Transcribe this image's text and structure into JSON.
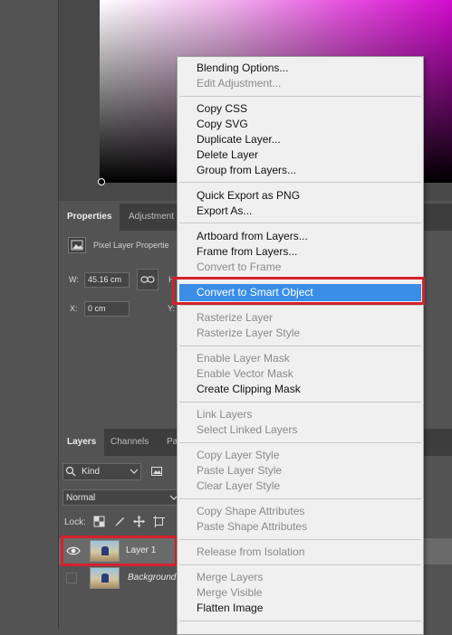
{
  "properties": {
    "tabs": [
      "Properties",
      "Adjustment"
    ],
    "header_label": "Pixel Layer Propertie",
    "w_label": "W:",
    "w_value": "45.16 cm",
    "h_label": "H",
    "x_label": "X:",
    "x_value": "0 cm",
    "y_label": "Y:"
  },
  "layers": {
    "tabs": [
      "Layers",
      "Channels",
      "Pa"
    ],
    "filter_kind": "Kind",
    "blend_mode": "Normal",
    "lock_label": "Lock:",
    "rows": [
      {
        "name": "Layer 1",
        "visible": true
      },
      {
        "name": "Background",
        "visible": false
      }
    ]
  },
  "context_menu": {
    "groups": [
      [
        {
          "label": "Blending Options...",
          "enabled": true
        },
        {
          "label": "Edit Adjustment...",
          "enabled": false
        }
      ],
      [
        {
          "label": "Copy CSS",
          "enabled": true
        },
        {
          "label": "Copy SVG",
          "enabled": true
        },
        {
          "label": "Duplicate Layer...",
          "enabled": true
        },
        {
          "label": "Delete Layer",
          "enabled": true
        },
        {
          "label": "Group from Layers...",
          "enabled": true
        }
      ],
      [
        {
          "label": "Quick Export as PNG",
          "enabled": true
        },
        {
          "label": "Export As...",
          "enabled": true
        }
      ],
      [
        {
          "label": "Artboard from Layers...",
          "enabled": true
        },
        {
          "label": "Frame from Layers...",
          "enabled": true
        },
        {
          "label": "Convert to Frame",
          "enabled": false
        }
      ],
      [
        {
          "label": "Convert to Smart Object",
          "enabled": true,
          "highlighted": true
        }
      ],
      [
        {
          "label": "Rasterize Layer",
          "enabled": false
        },
        {
          "label": "Rasterize Layer Style",
          "enabled": false
        }
      ],
      [
        {
          "label": "Enable Layer Mask",
          "enabled": false
        },
        {
          "label": "Enable Vector Mask",
          "enabled": false
        },
        {
          "label": "Create Clipping Mask",
          "enabled": true
        }
      ],
      [
        {
          "label": "Link Layers",
          "enabled": false
        },
        {
          "label": "Select Linked Layers",
          "enabled": false
        }
      ],
      [
        {
          "label": "Copy Layer Style",
          "enabled": false
        },
        {
          "label": "Paste Layer Style",
          "enabled": false
        },
        {
          "label": "Clear Layer Style",
          "enabled": false
        }
      ],
      [
        {
          "label": "Copy Shape Attributes",
          "enabled": false
        },
        {
          "label": "Paste Shape Attributes",
          "enabled": false
        }
      ],
      [
        {
          "label": "Release from Isolation",
          "enabled": false
        }
      ],
      [
        {
          "label": "Merge Layers",
          "enabled": false
        },
        {
          "label": "Merge Visible",
          "enabled": false
        },
        {
          "label": "Flatten Image",
          "enabled": true
        }
      ]
    ]
  },
  "colors": {
    "highlight": "#3a8ee6",
    "annotation_red": "#d4202c",
    "panel_bg": "#535353",
    "menu_bg": "#f0f0f0"
  },
  "icons": [
    "image-icon",
    "link-icon",
    "eye-icon",
    "search-icon",
    "chevron-down-icon",
    "filter-image-icon",
    "lock-transparent-icon",
    "lock-paint-icon",
    "lock-move-icon",
    "lock-artboard-icon"
  ]
}
